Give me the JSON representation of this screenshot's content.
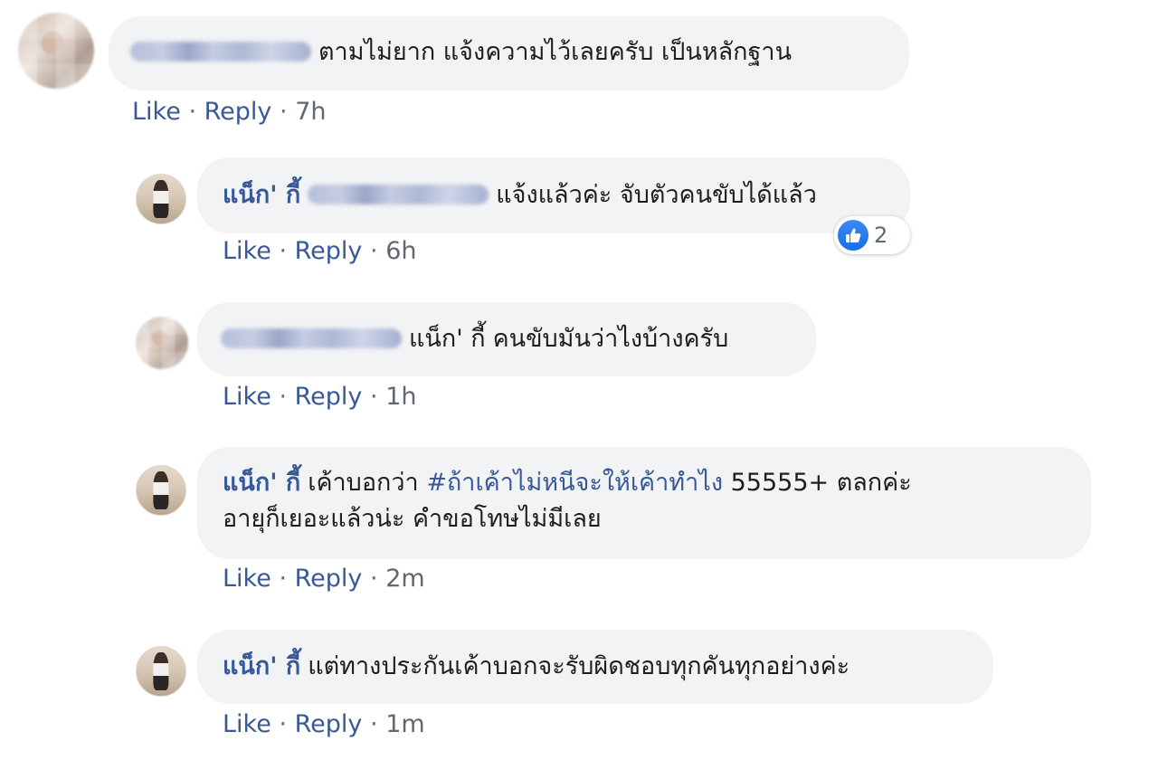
{
  "comments": [
    {
      "author": "",
      "text": "ตามไม่ยาก แจ้งความไว้เลยครับ เป็นหลักฐาน",
      "actions": {
        "like": "Like",
        "reply": "Reply",
        "sep": "·",
        "time": "7h"
      }
    },
    {
      "author": "แน็ก' กี้",
      "text": "แจ้งแล้วค่ะ จับตัวคนขับได้แล้ว",
      "actions": {
        "like": "Like",
        "reply": "Reply",
        "sep": "·",
        "time": "6h"
      },
      "reaction": {
        "icon": "thumbs-up-icon",
        "count": "2",
        "color": "#1877f2"
      }
    },
    {
      "author": "",
      "mention": "แน็ก' กี้",
      "text": "คนขับมันว่าไงบ้างครับ",
      "actions": {
        "like": "Like",
        "reply": "Reply",
        "sep": "·",
        "time": "1h"
      }
    },
    {
      "author": "แน็ก' กี้",
      "text_before": "เค้าบอกว่า",
      "hashtag": "#ถ้าเค้าไม่หนีจะให้เค้าทำไง",
      "text_after": "55555+ ตลกค่ะ",
      "text_line2": "อายุก็เยอะแล้วน่ะ คำขอโทษไม่มีเลย",
      "actions": {
        "like": "Like",
        "reply": "Reply",
        "sep": "·",
        "time": "2m"
      }
    },
    {
      "author": "แน็ก' กี้",
      "text": "แต่ทางประกันเค้าบอกจะรับผิดชอบทุกคันทุกอย่างค่ะ",
      "actions": {
        "like": "Like",
        "reply": "Reply",
        "sep": "·",
        "time": "1m"
      }
    }
  ],
  "colors": {
    "link": "#385898",
    "bubble": "#f2f3f5",
    "meta": "#616770",
    "like_blue": "#1877f2"
  }
}
